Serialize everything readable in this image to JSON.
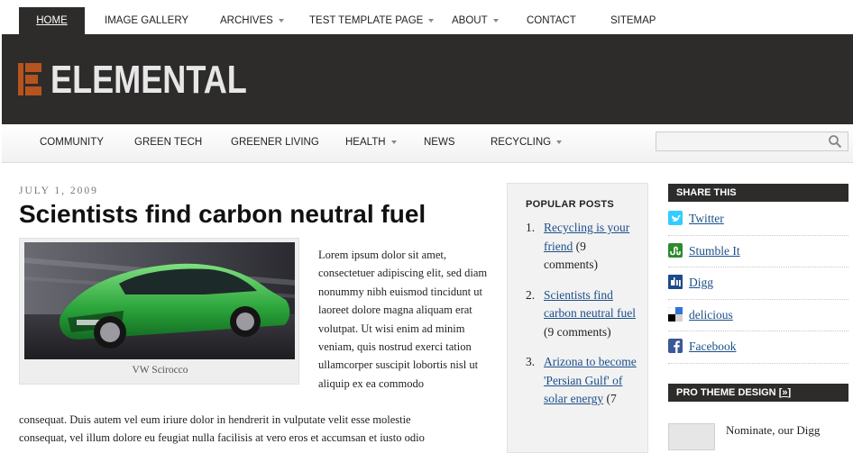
{
  "topnav": {
    "items": [
      {
        "label": "HOME",
        "active": true
      },
      {
        "label": "IMAGE GALLERY"
      },
      {
        "label": "ARCHIVES",
        "dropdown": true
      },
      {
        "label": "TEST TEMPLATE PAGE",
        "dropdown": true
      },
      {
        "label": "ABOUT",
        "dropdown": true
      },
      {
        "label": "CONTACT"
      },
      {
        "label": "SITEMAP"
      }
    ]
  },
  "header": {
    "logo_text": "ELEMENTAL",
    "bg_color": "#2d2c2b",
    "logo_color": "#b5541d"
  },
  "catnav": {
    "items": [
      {
        "label": "COMMUNITY"
      },
      {
        "label": "GREEN TECH"
      },
      {
        "label": "GREENER LIVING"
      },
      {
        "label": "HEALTH",
        "dropdown": true
      },
      {
        "label": "NEWS"
      },
      {
        "label": "RECYCLING",
        "dropdown": true
      }
    ],
    "search_placeholder": ""
  },
  "post": {
    "date": "JULY 1, 2009",
    "title": "Scientists find carbon neutral fuel",
    "image_caption": "VW Scirocco",
    "body_right": "Lorem ipsum dolor sit amet, consectetuer adipiscing elit, sed diam nonummy nibh euismod tincidunt ut laoreet dolore magna aliquam erat volutpat. Ut wisi enim ad minim veniam, quis nostrud exerci tation ullamcorper suscipit lobortis nisl ut aliquip ex ea commodo",
    "body_full_1": "consequat. Duis autem vel eum iriure dolor in hendrerit in vulputate velit esse molestie",
    "body_full_2": "consequat, vel illum dolore eu feugiat nulla facilisis at vero eros et accumsan et iusto odio"
  },
  "popular": {
    "heading": "POPULAR POSTS",
    "items": [
      {
        "num": "1.",
        "title": "Recycling is your friend",
        "comments": "(9 comments)"
      },
      {
        "num": "2.",
        "title": "Scientists find carbon neutral fuel",
        "comments": "(9 comments)"
      },
      {
        "num": "3.",
        "title": "Arizona to become 'Persian Gulf' of solar energy",
        "comments": "(7"
      }
    ]
  },
  "share": {
    "heading": "SHARE THIS",
    "items": [
      {
        "label": "Twitter",
        "icon": "twitter-icon",
        "color": "#33ccff"
      },
      {
        "label": "Stumble It",
        "icon": "stumbleupon-icon",
        "color": "#2d8a2d"
      },
      {
        "label": "Digg",
        "icon": "digg-icon",
        "color": "#1d4b8a"
      },
      {
        "label": "delicious",
        "icon": "delicious-icon",
        "color": "#3274d1"
      },
      {
        "label": "Facebook",
        "icon": "facebook-icon",
        "color": "#3b5998"
      }
    ]
  },
  "pro": {
    "heading": "PRO THEME DESIGN",
    "link": "»",
    "text": "Nominate, our Digg"
  }
}
